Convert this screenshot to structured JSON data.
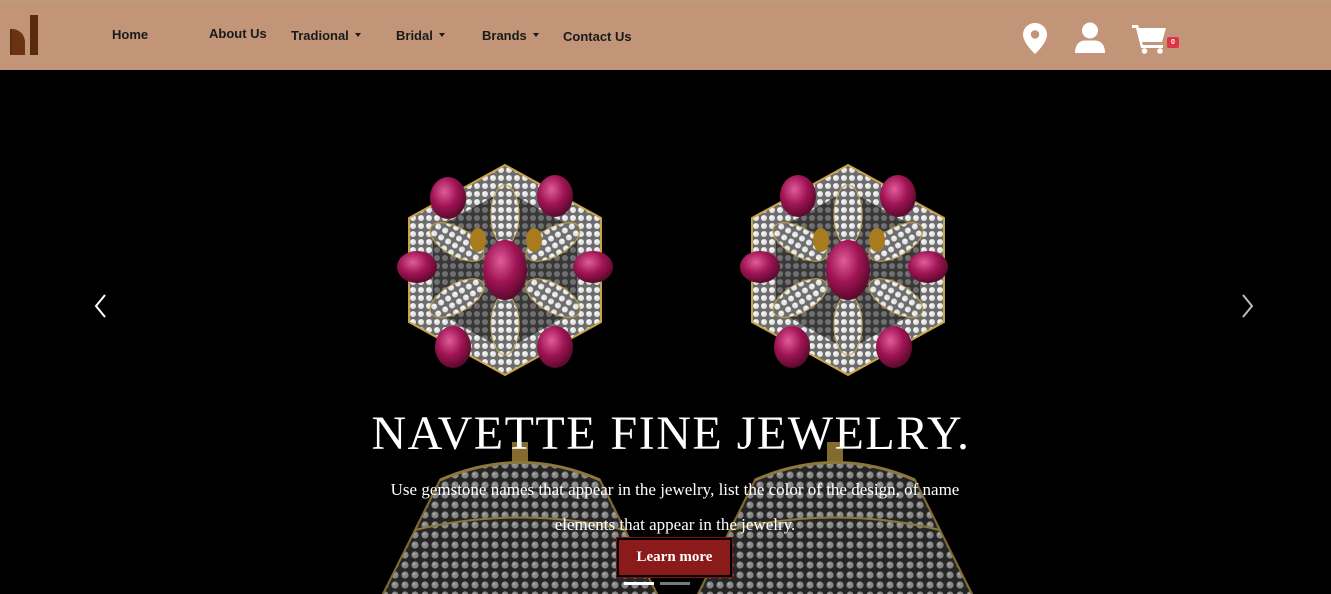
{
  "brand": {
    "logo_icon": "d-letter-logo"
  },
  "nav": {
    "home": "Home",
    "about": "About Us",
    "traditional": "Tradional",
    "bridal": "Bridal",
    "brands": "Brands",
    "contact": "Contact Us"
  },
  "icons": {
    "location": "map-marker-icon",
    "account": "user-icon",
    "cart": "shopping-cart-icon"
  },
  "cart": {
    "count": "0"
  },
  "colors": {
    "navbar": "#c29478",
    "logo": "#5a2a0c",
    "button": "#8b1a1a",
    "badge": "#dc3545",
    "gem": "#a01454"
  },
  "hero": {
    "title": "NAVETTE FINE JEWELRY.",
    "description": "Use gemstone names that appear in the jewelry, list the color of the design, of name elements that appear in the jewelry.",
    "button_label": "Learn more",
    "slides_total": 2,
    "active_slide": 1
  }
}
